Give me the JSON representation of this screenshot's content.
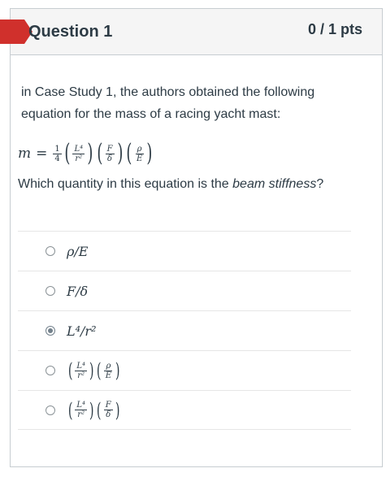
{
  "question": {
    "title": "Question 1",
    "points": "0 / 1 pts",
    "intro": "in Case Study 1, the authors obtained the following equation for the mass of a racing yacht mast:",
    "prompt_before": "Which quantity in this equation is the ",
    "prompt_emph": "beam stiffness",
    "prompt_after": "?"
  },
  "equation": {
    "lhs": "m",
    "eq": "=",
    "f1_num": "1",
    "f1_den": "4",
    "f2_num": "L⁴",
    "f2_den": "r²",
    "f3_num": "F",
    "f3_den": "δ",
    "f4_num": "ρ",
    "f4_den": "E"
  },
  "answers": [
    {
      "label": "ρ/E",
      "selected": false
    },
    {
      "label": "F/δ",
      "selected": false
    },
    {
      "label": "L⁴/r²",
      "selected": true
    },
    {
      "label": "(L⁴/r²)(ρ/E)",
      "selected": false,
      "n1": "L⁴",
      "d1": "r²",
      "n2": "ρ",
      "d2": "E"
    },
    {
      "label": "(L⁴/r²)(F/δ)",
      "selected": false,
      "n1": "L⁴",
      "d1": "r²",
      "n2": "F",
      "d2": "δ"
    }
  ],
  "colors": {
    "flag": "#d0302c",
    "header_bg": "#f5f5f5",
    "text": "#2d3b45"
  }
}
